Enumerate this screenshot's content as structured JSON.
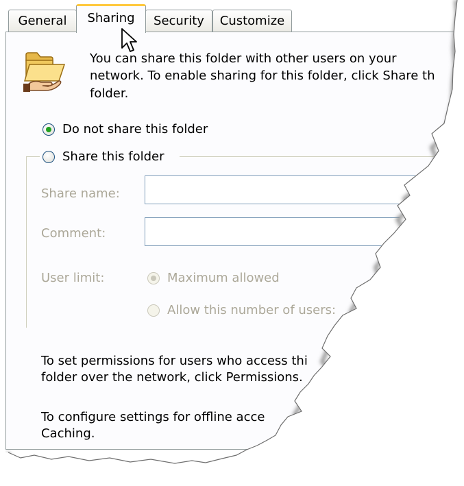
{
  "tabs": [
    {
      "label": "General"
    },
    {
      "label": "Sharing"
    },
    {
      "label": "Security"
    },
    {
      "label": "Customize"
    }
  ],
  "intro": {
    "line1": "You can share this folder with other users on your",
    "line2": "network.  To enable sharing for this folder, click Share th",
    "line3": "folder."
  },
  "sharing": {
    "do_not_share_label": "Do not share this folder",
    "do_not_share_selected": true,
    "share_label": "Share this folder",
    "share_selected": false
  },
  "share_settings": {
    "share_name_label": "Share name:",
    "share_name_value": "",
    "comment_label": "Comment:",
    "comment_value": "",
    "user_limit_label": "User limit:",
    "maximum_allowed_label": "Maximum allowed",
    "allow_number_label": "Allow this number of users:"
  },
  "permissions_text": {
    "line1": "To set permissions for users who access thi",
    "line2": "folder over the network, click Permissions."
  },
  "caching_text": {
    "line1": "To configure settings for offline acce",
    "line2": "Caching."
  },
  "colors": {
    "tab_highlight": "#ffc83c",
    "radio_selected": "#21a121",
    "disabled_text": "#aca899",
    "field_border": "#7f9db9"
  },
  "icons": {
    "folder": "shared-folder-icon",
    "cursor": "mouse-pointer-icon"
  }
}
